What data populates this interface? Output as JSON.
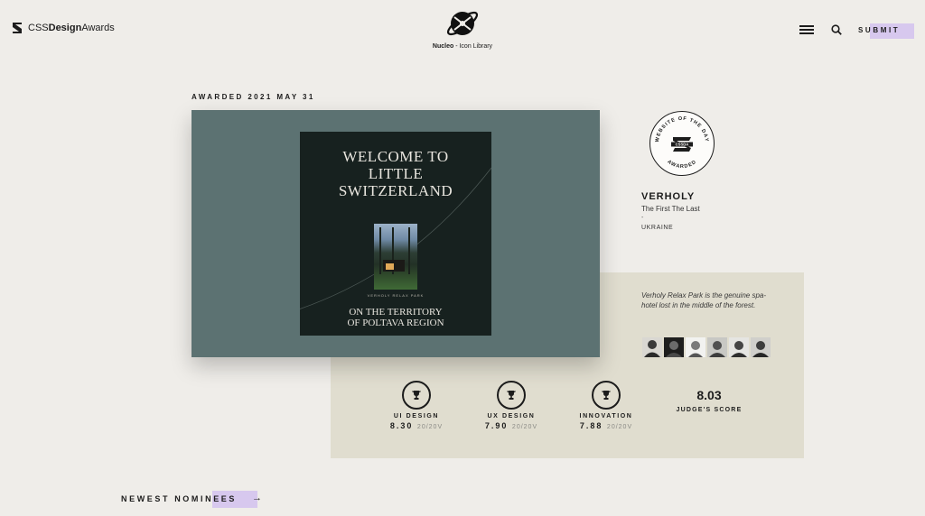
{
  "header": {
    "logo_prefix": "CSS",
    "logo_bold": "Design",
    "logo_suffix": "Awards",
    "sponsor_name": "Nucleo",
    "sponsor_suffix": " - Icon Library",
    "menu_icon": "hamburger-icon",
    "search_icon": "search-icon",
    "submit_label": "SUBMIT"
  },
  "award": {
    "date_label": "AWARDED 2021 MAY 31",
    "badge_text": "WEBSITE OF THE DAY",
    "badge_bottom": "AWARDED",
    "badge_mark": "CSSDA"
  },
  "preview": {
    "title": "WELCOME TO\nLITTLE\nSWITZERLAND",
    "caption": "VERHOLY RELAX PARK",
    "subtitle": "ON THE TERRITORY\nOF POLTAVA REGION"
  },
  "site": {
    "name": "VERHOLY",
    "author": "The First The Last",
    "separator": "-",
    "country": "UKRAINE",
    "description": "Verholy Relax Park is the genuine spa-hotel lost in the middle of the forest."
  },
  "judges_count": 6,
  "scores": [
    {
      "label": "UI DESIGN",
      "value": "8.30",
      "votes": "20/20V",
      "icon": "trophy-icon"
    },
    {
      "label": "UX DESIGN",
      "value": "7.90",
      "votes": "20/20V",
      "icon": "trophy-icon"
    },
    {
      "label": "INNOVATION",
      "value": "7.88",
      "votes": "20/20V",
      "icon": "trophy-icon"
    }
  ],
  "judge_score": {
    "value": "8.03",
    "label": "JUDGE'S SCORE"
  },
  "newest": {
    "label": "NEWEST NOMINEES",
    "arrow": "→"
  },
  "colors": {
    "accent": "#d7c8ee",
    "background": "#efede9",
    "card": "#e0ddcf",
    "preview_bg": "#5c7272",
    "poster_bg": "#17211f"
  }
}
